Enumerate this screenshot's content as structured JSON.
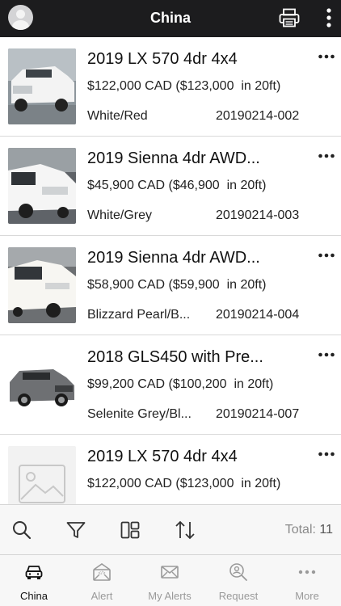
{
  "header": {
    "title": "China",
    "avatar_icon": "user-avatar-icon",
    "print_icon": "printer-icon",
    "menu_icon": "vertical-ellipsis-icon"
  },
  "listings": [
    {
      "title": "2019 LX 570 4dr 4x4",
      "price": "$122,000 CAD ($123,000  in 20ft)",
      "color": "White/Red",
      "stock": "20190214-002",
      "more": "more-icon"
    },
    {
      "title": "2019 Sienna 4dr AWD...",
      "price": "$45,900 CAD ($46,900  in 20ft)",
      "color": "White/Grey",
      "stock": "20190214-003",
      "more": "more-icon"
    },
    {
      "title": "2019 Sienna 4dr AWD...",
      "price": "$58,900 CAD ($59,900  in 20ft)",
      "color": "Blizzard Pearl/B...",
      "stock": "20190214-004",
      "more": "more-icon"
    },
    {
      "title": "2018 GLS450 with Pre...",
      "price": "$99,200 CAD ($100,200  in 20ft)",
      "color": "Selenite Grey/Bl...",
      "stock": "20190214-007",
      "more": "more-icon"
    },
    {
      "title": "2019 LX 570 4dr 4x4",
      "price": "$122,000 CAD ($123,000  in 20ft)",
      "color": "",
      "stock": "",
      "more": "more-icon"
    }
  ],
  "toolbar": {
    "icons": [
      "search-icon",
      "filter-icon",
      "layout-toggle-icon",
      "sort-icon"
    ],
    "total_label": "Total: ",
    "total_count": "11"
  },
  "tabs": [
    {
      "label": "China",
      "icon": "car-icon",
      "active": true
    },
    {
      "label": "Alert",
      "icon": "alert-mail-icon",
      "active": false
    },
    {
      "label": "My Alerts",
      "icon": "envelope-icon",
      "active": false
    },
    {
      "label": "Request",
      "icon": "search-request-icon",
      "active": false
    },
    {
      "label": "More",
      "icon": "ellipsis-icon",
      "active": false
    }
  ],
  "colors": {
    "header_bg": "#1c1c1e",
    "toolbar_bg": "#f7f7f7",
    "muted_text": "#9a9a9a"
  }
}
